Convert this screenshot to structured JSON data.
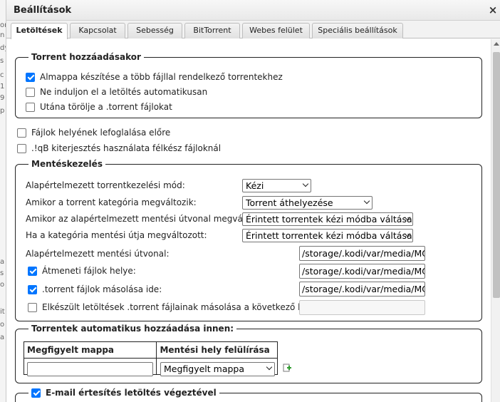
{
  "dialog": {
    "title": "Beállítások",
    "close_glyph": "×"
  },
  "tabs": [
    {
      "label": "Letöltések",
      "active": true
    },
    {
      "label": "Kapcsolat",
      "active": false
    },
    {
      "label": "Sebesség",
      "active": false
    },
    {
      "label": "BitTorrent",
      "active": false
    },
    {
      "label": "Webes felület",
      "active": false
    },
    {
      "label": "Speciális beállítások",
      "active": false
    }
  ],
  "background_fragments": [
    "or",
    "n",
    "dy",
    "s",
    "c",
    "1",
    "9",
    "p",
    "a",
    "s",
    "o",
    "it",
    "o",
    "a"
  ],
  "add_torrent": {
    "legend": "Torrent hozzáadásakor",
    "options": [
      {
        "label": "Almappa készítése a több fájllal rendelkező torrentekhez",
        "checked": true
      },
      {
        "label": "Ne induljon el a letöltés automatikusan",
        "checked": false
      },
      {
        "label": "Utána törölje a .torrent fájlokat",
        "checked": false
      }
    ]
  },
  "general_options": [
    {
      "label": "Fájlok helyének lefoglalása előre",
      "checked": false
    },
    {
      "label": ".!qB kiterjesztés használata félkész fájloknál",
      "checked": false
    }
  ],
  "saving": {
    "legend": "Mentéskezelés",
    "default_mode": {
      "label": "Alapértelmezett torrentkezelési mód:",
      "value": "Kézi"
    },
    "category_changed": {
      "label": "Amikor a torrent kategória megváltozik:",
      "value": "Torrent áthelyezése"
    },
    "default_path_changed": {
      "label": "Amikor az alapértelmezett mentési útvonal megváltozik:",
      "value": "Érintett torrentek kézi módba váltása"
    },
    "category_path_changed": {
      "label": "Ha a kategória mentési útja megváltozott:",
      "value": "Érintett torrentek kézi módba váltása"
    },
    "default_save_path": {
      "label": "Alapértelmezett mentési útvonal:",
      "value": "/storage/.kodi/var/media/MO'"
    },
    "temp_path": {
      "label": "Átmeneti fájlok helye:",
      "checked": true,
      "value": "/storage/.kodi/var/media/MO'"
    },
    "copy_torrent": {
      "label": ".torrent fájlok másolása ide:",
      "checked": true,
      "value": "/storage/.kodi/var/media/MO'"
    },
    "copy_finished": {
      "label": "Elkészült letöltések .torrent fájlainak másolása a következő helyre:",
      "checked": false,
      "value": ""
    }
  },
  "auto_add": {
    "legend": "Torrentek automatikus hozzáadása innen:",
    "col_folder": "Megfigyelt mappa",
    "col_override": "Mentési hely felülírása",
    "folder_value": "",
    "override_value": "Megfigyelt mappa",
    "add_icon": "add-row-icon"
  },
  "email": {
    "legend": "E-mail értesítés letöltés végeztével",
    "checked": true
  },
  "colors": {
    "accent": "#0075ff",
    "add_icon_green": "#2e9b2e"
  }
}
